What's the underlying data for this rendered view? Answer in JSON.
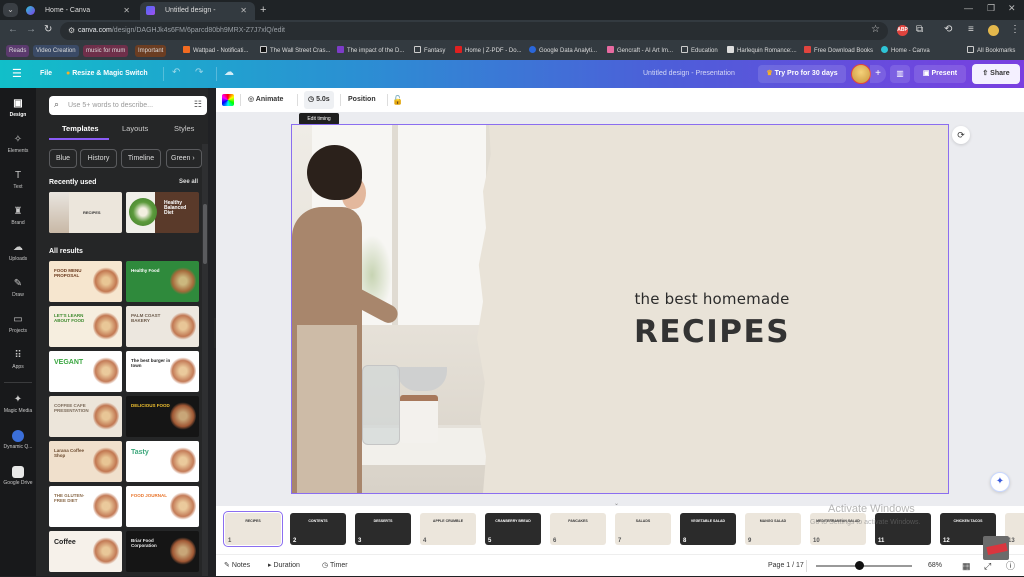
{
  "browser": {
    "tabs": [
      {
        "title": "Home - Canva",
        "active": false
      },
      {
        "title": "Untitled design - Presentation",
        "active": true
      }
    ],
    "url_domain": "canva.com",
    "url_path": "/design/DAGHJk4s6FM/6parcd80bh9MRX-Z7J7xlQ/edit",
    "bookmarks": [
      {
        "label": "Reads",
        "type": "pill",
        "color": "#5b3a6e"
      },
      {
        "label": "Video Creation",
        "type": "pill",
        "color": "#3a4a66"
      },
      {
        "label": "music for mum",
        "type": "pill",
        "color": "#6e2f4a"
      },
      {
        "label": "Important",
        "type": "pill",
        "color": "#6b3d22"
      },
      {
        "label": "Wattpad - Notificati...",
        "type": "link",
        "icon_color": "#f26b21"
      },
      {
        "label": "The Wall Street Cras...",
        "type": "link",
        "icon_color": "#111111"
      },
      {
        "label": "The impact of the D...",
        "type": "link",
        "icon_color": "#7d3cc8"
      },
      {
        "label": "Fantasy",
        "type": "folder"
      },
      {
        "label": "Home | Z-PDF - Do...",
        "type": "link",
        "icon_color": "#e02020"
      },
      {
        "label": "Google Data Analyti...",
        "type": "link",
        "icon_color": "#2a66d9"
      },
      {
        "label": "Gencraft - AI Art Im...",
        "type": "link",
        "icon_color": "#e86aa0"
      },
      {
        "label": "Education",
        "type": "folder"
      },
      {
        "label": "Harlequin Romance:...",
        "type": "link",
        "icon_color": "#dddddd"
      },
      {
        "label": "Free Download Books",
        "type": "link",
        "icon_color": "#e0443e"
      },
      {
        "label": "Home - Canva",
        "type": "link",
        "icon_color": "#2ec4d6"
      },
      {
        "label": "All Bookmarks",
        "type": "folder"
      }
    ],
    "extensions": [
      {
        "name": "adblock",
        "label": "ABP",
        "color": "#e0443e"
      }
    ]
  },
  "header": {
    "menu_icon": "hamburger-icon",
    "file_label": "File",
    "resize_label": "Resize & Magic Switch",
    "design_title": "Untitled design - Presentation",
    "try_pro_label": "Try Pro for 30 days",
    "present_label": "Present",
    "share_label": "Share"
  },
  "rail": {
    "items": [
      {
        "label": "Design",
        "icon": "▣",
        "active": true
      },
      {
        "label": "Elements",
        "icon": "✧",
        "active": false
      },
      {
        "label": "Text",
        "icon": "T",
        "active": false
      },
      {
        "label": "Brand",
        "icon": "♜",
        "active": false
      },
      {
        "label": "Uploads",
        "icon": "☁",
        "active": false
      },
      {
        "label": "Draw",
        "icon": "✎",
        "active": false
      },
      {
        "label": "Projects",
        "icon": "▭",
        "active": false
      },
      {
        "label": "Apps",
        "icon": "⠿",
        "active": false
      },
      {
        "label": "Magic Media",
        "icon": "✦",
        "active": false
      },
      {
        "label": "Dynamic Q...",
        "icon": "app",
        "active": false,
        "color": "#3b6fd9"
      },
      {
        "label": "Google Drive",
        "icon": "app",
        "active": false,
        "color": "#e8e8e8"
      }
    ]
  },
  "panel": {
    "search_placeholder": "Use 5+ words to describe...",
    "tabs": [
      "Templates",
      "Layouts",
      "Styles"
    ],
    "active_tab": "Templates",
    "chips": [
      "Blue",
      "History",
      "Timeline",
      "Green"
    ],
    "recently_used_title": "Recently used",
    "see_all_label": "See all",
    "recently_used": [
      {
        "title": "RECIPES",
        "bg": "#ece6dc",
        "fg": "#333333"
      },
      {
        "title": "Healthy Balanced Diet",
        "bg": "#5a3a2a",
        "fg": "#ffffff"
      }
    ],
    "all_results_title": "All results",
    "templates": [
      {
        "title": "FOOD MENU PROPOSAL",
        "bg": "#f6e6cf",
        "fg": "#6b3a1e"
      },
      {
        "title": "Healthy Food",
        "bg": "#2f8a3c",
        "fg": "#ffffff"
      },
      {
        "title": "LET'S LEARN ABOUT FOOD",
        "bg": "#f6eedf",
        "fg": "#3d8a2e"
      },
      {
        "title": "PALM COAST BAKERY",
        "bg": "#ece7df",
        "fg": "#6b5a4a"
      },
      {
        "title": "VEGANT",
        "bg": "#ffffff",
        "fg": "#3aa640"
      },
      {
        "title": "The best burger in town",
        "bg": "#ffffff",
        "fg": "#222222"
      },
      {
        "title": "COFFEE CAFE PRESENTATION",
        "bg": "#ece5da",
        "fg": "#7a6a5a"
      },
      {
        "title": "DELICIOUS FOOD",
        "bg": "#151515",
        "fg": "#f4c430"
      },
      {
        "title": "Larana Coffee Shop",
        "bg": "#f0e0cc",
        "fg": "#6b4a2e"
      },
      {
        "title": "Tasty",
        "bg": "#ffffff",
        "fg": "#3aa67a"
      },
      {
        "title": "THE GLUTEN-FREE DIET",
        "bg": "#ffffff",
        "fg": "#8a6a4a"
      },
      {
        "title": "FOOD JOURNAL",
        "bg": "#ffffff",
        "fg": "#e8742a"
      },
      {
        "title": "Coffee",
        "bg": "#f6f1ea",
        "fg": "#222222"
      },
      {
        "title": "Briar Food Corporation",
        "bg": "#151515",
        "fg": "#eeeeee"
      }
    ]
  },
  "context_toolbar": {
    "animate_label": "Animate",
    "timing_label": "5.0s",
    "position_label": "Position",
    "tooltip": "Edit timing"
  },
  "slide": {
    "subtitle": "the best homemade",
    "title": "RECIPES"
  },
  "pages": [
    {
      "number": "1",
      "title": "RECIPES",
      "bg": "#ece6dc",
      "fg": "#333333",
      "selected": true
    },
    {
      "number": "2",
      "title": "CONTENTS",
      "bg": "#2b2b2b",
      "fg": "#ffffff"
    },
    {
      "number": "3",
      "title": "DESSERTS",
      "bg": "#2b2b2b",
      "fg": "#ffffff"
    },
    {
      "number": "4",
      "title": "APPLE CRUMBLE",
      "bg": "#ece6dc",
      "fg": "#333333"
    },
    {
      "number": "5",
      "title": "CRANBERRY BREAD",
      "bg": "#2b2b2b",
      "fg": "#ffffff"
    },
    {
      "number": "6",
      "title": "PANCAKES",
      "bg": "#ece6dc",
      "fg": "#333333"
    },
    {
      "number": "7",
      "title": "SALADS",
      "bg": "#ece6dc",
      "fg": "#333333"
    },
    {
      "number": "8",
      "title": "VEGETABLE SALAD",
      "bg": "#2b2b2b",
      "fg": "#ffffff"
    },
    {
      "number": "9",
      "title": "MANGO SALAD",
      "bg": "#ece6dc",
      "fg": "#333333"
    },
    {
      "number": "10",
      "title": "MEDITERRANEAN SALAD",
      "bg": "#ece6dc",
      "fg": "#333333"
    },
    {
      "number": "11",
      "title": "",
      "bg": "#2b2b2b",
      "fg": "#ffffff"
    },
    {
      "number": "12",
      "title": "CHICKEN TACOS",
      "bg": "#2b2b2b",
      "fg": "#ffffff"
    },
    {
      "number": "13",
      "title": "",
      "bg": "#ece6dc",
      "fg": "#333333"
    }
  ],
  "footer": {
    "notes_label": "Notes",
    "duration_label": "Duration",
    "timer_label": "Timer",
    "page_indicator": "Page 1 / 17",
    "zoom_percent": "68%",
    "zoom_slider_fraction": 0.45
  },
  "watermark": {
    "line1": "Activate Windows",
    "line2": "Go to Settings to activate Windows."
  }
}
